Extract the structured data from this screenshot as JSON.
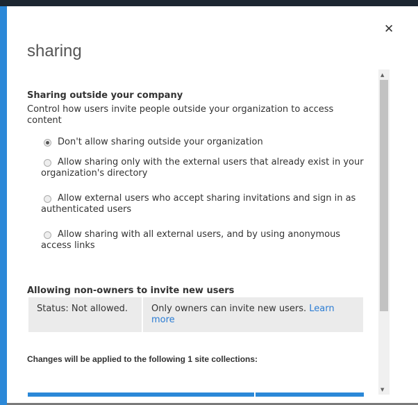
{
  "dialog": {
    "title": "sharing",
    "close_icon": "close-icon"
  },
  "external": {
    "heading": "Sharing outside your company",
    "description": "Control how users invite people outside your organization to access content",
    "options": [
      {
        "label": "Don't allow sharing outside your organization",
        "selected": true
      },
      {
        "label": "Allow sharing only with the external users that already exist in your organization's directory",
        "selected": false
      },
      {
        "label": "Allow external users who accept sharing invitations and sign in as authenticated users",
        "selected": false
      },
      {
        "label": "Allow sharing with all external users, and by using anonymous access links",
        "selected": false
      }
    ]
  },
  "invite": {
    "heading": "Allowing non-owners to invite new users",
    "status": "Status: Not allowed.",
    "info": "Only owners can invite new users.",
    "link": "Learn more"
  },
  "changes": {
    "heading": "Changes will be applied to the following 1 site collections:"
  }
}
